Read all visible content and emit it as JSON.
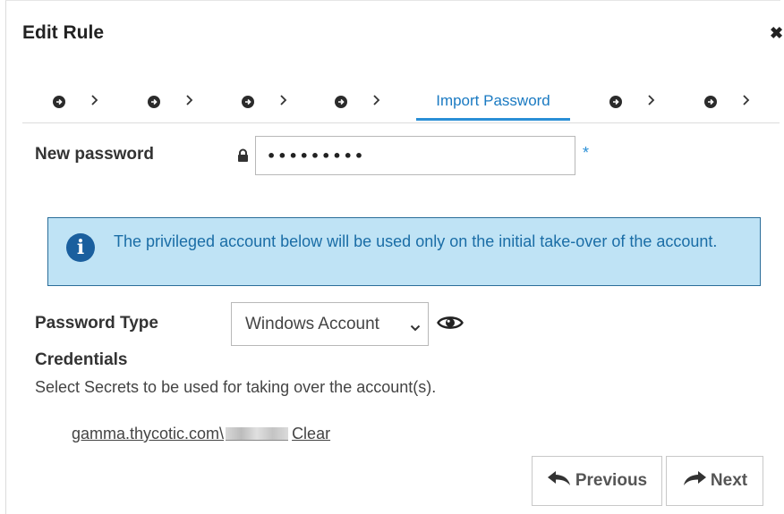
{
  "dialog": {
    "title": "Edit Rule",
    "close_glyph": "✖"
  },
  "wizard": {
    "active_step_label": "Import Password",
    "collapsed_step_count": 6,
    "icons": {
      "collapsed_step": "arrow-circle-right-icon",
      "separator": "chevron-right-icon"
    }
  },
  "new_password": {
    "label": "New password",
    "value": "•••••••••",
    "required_mark": "*",
    "icon": "lock-icon"
  },
  "info_box": {
    "icon": "info-icon",
    "message": "The privileged account below will be used only on the initial take-over of the account."
  },
  "password_type": {
    "label": "Password Type",
    "selected": "Windows Account",
    "eye_icon": "eye-icon"
  },
  "credentials": {
    "heading": "Credentials",
    "description": "Select Secrets to be used for taking over the account(s).",
    "secret_prefix": "gamma.thycotic.com\\",
    "clear_label": "Clear"
  },
  "buttons": {
    "previous": "Previous",
    "next": "Next"
  },
  "colors": {
    "accent": "#2a8fd6",
    "info_background": "#bfe3f5",
    "info_border": "#2a6d99",
    "info_text": "#1a6da6"
  }
}
